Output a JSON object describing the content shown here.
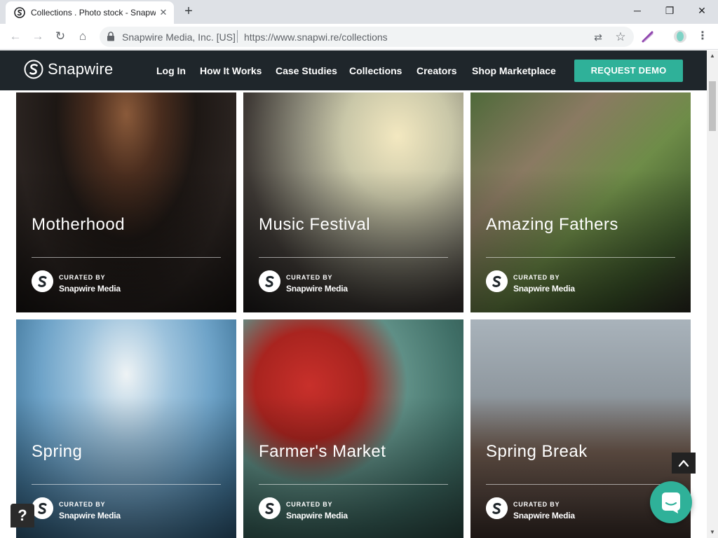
{
  "browser": {
    "tab_title": "Collections . Photo stock - Snapwire",
    "tab_close": "✕",
    "new_tab": "+",
    "window": {
      "minimize": "─",
      "maximize": "❐",
      "close": "✕"
    },
    "nav": {
      "back": "←",
      "forward": "→",
      "reload": "↻",
      "home": "⌂"
    },
    "omnibox": {
      "org": "Snapwire Media, Inc. [US]",
      "url": "https://www.snapwi.re/collections"
    },
    "translate_icon": "⇄",
    "star_icon": "☆",
    "menu_icon": "⋮"
  },
  "site": {
    "logo_text": "Snapwire",
    "nav": [
      {
        "label": "Log In"
      },
      {
        "label": "How It Works"
      },
      {
        "label": "Case Studies"
      },
      {
        "label": "Collections"
      },
      {
        "label": "Creators"
      },
      {
        "label": "Shop Marketplace"
      }
    ],
    "cta": "REQUEST DEMO",
    "brand_color": "#2fb199",
    "header_bg": "#1f262b"
  },
  "collections": [
    {
      "title": "Motherhood",
      "curated_by": "CURATED BY",
      "curator": "Snapwire Media"
    },
    {
      "title": "Music Festival",
      "curated_by": "CURATED BY",
      "curator": "Snapwire Media"
    },
    {
      "title": "Amazing Fathers",
      "curated_by": "CURATED BY",
      "curator": "Snapwire Media"
    },
    {
      "title": "Spring",
      "curated_by": "CURATED BY",
      "curator": "Snapwire Media"
    },
    {
      "title": "Farmer's Market",
      "curated_by": "CURATED BY",
      "curator": "Snapwire Media"
    },
    {
      "title": "Spring Break",
      "curated_by": "CURATED BY",
      "curator": "Snapwire Media"
    }
  ],
  "widgets": {
    "help": "?",
    "to_top": "︿"
  },
  "scrollbar": {
    "up": "▲",
    "down": "▼"
  }
}
